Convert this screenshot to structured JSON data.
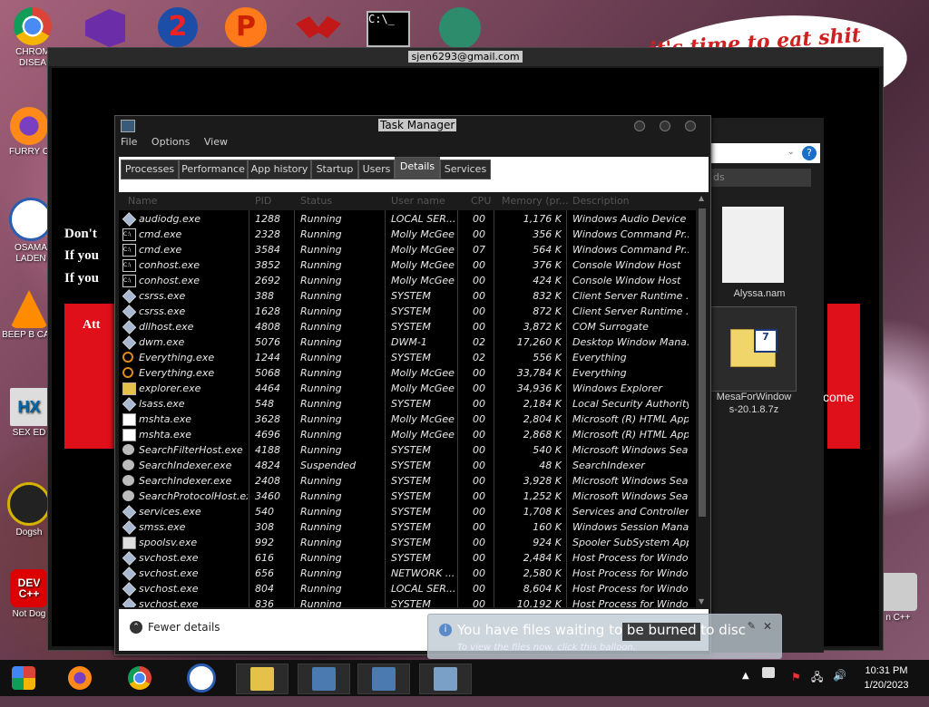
{
  "desktop": {
    "speech_text": "it's time to eat shit",
    "speech_text_fragment": "te",
    "icons": [
      {
        "label": "CHROM DISEA",
        "name": "chrome-desktop-icon"
      },
      {
        "label": "FURRY C",
        "name": "firefox-desktop-icon"
      },
      {
        "label": "OSAMA LADEN",
        "name": "obama-desktop-icon"
      },
      {
        "label": "BEEP B CAR",
        "name": "vlc-desktop-icon"
      },
      {
        "label": "SEX ED",
        "name": "hx-desktop-icon"
      },
      {
        "label": "Dogsh",
        "name": "dogsh-desktop-icon"
      },
      {
        "label": "Not Dog",
        "name": "devcpp-desktop-icon"
      }
    ],
    "right_icon_label": "n C++"
  },
  "bg_window": {
    "title": "sjen6293@gmail.com",
    "lines": [
      "Don't",
      "If you",
      "If you"
    ],
    "att": "Att",
    "come": "come"
  },
  "explorer": {
    "search_fragment": "ds",
    "file1": "Alyssa.nam",
    "file2_line1": "MesaForWindow",
    "file2_line2": "s-20.1.8.7z"
  },
  "task_manager": {
    "title": "Task Manager",
    "menu": [
      "File",
      "Options",
      "View"
    ],
    "tabs": [
      "Processes",
      "Performance",
      "App history",
      "Startup",
      "Users",
      "Details",
      "Services"
    ],
    "active_tab": "Details",
    "columns": [
      "Name",
      "PID",
      "Status",
      "User name",
      "CPU",
      "Memory (pr...",
      "Description"
    ],
    "rows": [
      {
        "icon": "gen",
        "name": "audiodg.exe",
        "pid": "1288",
        "status": "Running",
        "user": "LOCAL SER...",
        "cpu": "00",
        "mem": "1,176 K",
        "desc": "Windows Audio Device ..."
      },
      {
        "icon": "cmd",
        "name": "cmd.exe",
        "pid": "2328",
        "status": "Running",
        "user": "Molly McGee",
        "cpu": "00",
        "mem": "356 K",
        "desc": "Windows Command Pr..."
      },
      {
        "icon": "cmd",
        "name": "cmd.exe",
        "pid": "3584",
        "status": "Running",
        "user": "Molly McGee",
        "cpu": "07",
        "mem": "564 K",
        "desc": "Windows Command Pr..."
      },
      {
        "icon": "cmd",
        "name": "conhost.exe",
        "pid": "3852",
        "status": "Running",
        "user": "Molly McGee",
        "cpu": "00",
        "mem": "376 K",
        "desc": "Console Window Host"
      },
      {
        "icon": "cmd",
        "name": "conhost.exe",
        "pid": "2692",
        "status": "Running",
        "user": "Molly McGee",
        "cpu": "00",
        "mem": "424 K",
        "desc": "Console Window Host"
      },
      {
        "icon": "gen",
        "name": "csrss.exe",
        "pid": "388",
        "status": "Running",
        "user": "SYSTEM",
        "cpu": "00",
        "mem": "832 K",
        "desc": "Client Server Runtime ..."
      },
      {
        "icon": "gen",
        "name": "csrss.exe",
        "pid": "1628",
        "status": "Running",
        "user": "SYSTEM",
        "cpu": "00",
        "mem": "872 K",
        "desc": "Client Server Runtime ..."
      },
      {
        "icon": "gen",
        "name": "dllhost.exe",
        "pid": "4808",
        "status": "Running",
        "user": "SYSTEM",
        "cpu": "00",
        "mem": "3,872 K",
        "desc": "COM Surrogate"
      },
      {
        "icon": "gen",
        "name": "dwm.exe",
        "pid": "5076",
        "status": "Running",
        "user": "DWM-1",
        "cpu": "02",
        "mem": "17,260 K",
        "desc": "Desktop Window Mana..."
      },
      {
        "icon": "search",
        "name": "Everything.exe",
        "pid": "1244",
        "status": "Running",
        "user": "SYSTEM",
        "cpu": "02",
        "mem": "556 K",
        "desc": "Everything"
      },
      {
        "icon": "search",
        "name": "Everything.exe",
        "pid": "5068",
        "status": "Running",
        "user": "Molly McGee",
        "cpu": "00",
        "mem": "33,784 K",
        "desc": "Everything"
      },
      {
        "icon": "explorer",
        "name": "explorer.exe",
        "pid": "4464",
        "status": "Running",
        "user": "Molly McGee",
        "cpu": "00",
        "mem": "34,936 K",
        "desc": "Windows Explorer"
      },
      {
        "icon": "gen",
        "name": "lsass.exe",
        "pid": "548",
        "status": "Running",
        "user": "SYSTEM",
        "cpu": "00",
        "mem": "2,184 K",
        "desc": "Local Security Authority..."
      },
      {
        "icon": "mshta",
        "name": "mshta.exe",
        "pid": "3628",
        "status": "Running",
        "user": "Molly McGee",
        "cpu": "00",
        "mem": "2,804 K",
        "desc": "Microsoft (R) HTML App..."
      },
      {
        "icon": "mshta",
        "name": "mshta.exe",
        "pid": "4696",
        "status": "Running",
        "user": "Molly McGee",
        "cpu": "00",
        "mem": "2,868 K",
        "desc": "Microsoft (R) HTML App..."
      },
      {
        "icon": "gear",
        "name": "SearchFilterHost.exe",
        "pid": "4188",
        "status": "Running",
        "user": "SYSTEM",
        "cpu": "00",
        "mem": "540 K",
        "desc": "Microsoft Windows Sea..."
      },
      {
        "icon": "gear",
        "name": "SearchIndexer.exe",
        "pid": "4824",
        "status": "Suspended",
        "user": "SYSTEM",
        "cpu": "00",
        "mem": "48 K",
        "desc": "SearchIndexer"
      },
      {
        "icon": "gear",
        "name": "SearchIndexer.exe",
        "pid": "2408",
        "status": "Running",
        "user": "SYSTEM",
        "cpu": "00",
        "mem": "3,928 K",
        "desc": "Microsoft Windows Sea..."
      },
      {
        "icon": "gear",
        "name": "SearchProtocolHost.exe",
        "pid": "3460",
        "status": "Running",
        "user": "SYSTEM",
        "cpu": "00",
        "mem": "1,252 K",
        "desc": "Microsoft Windows Sea..."
      },
      {
        "icon": "gen",
        "name": "services.exe",
        "pid": "540",
        "status": "Running",
        "user": "SYSTEM",
        "cpu": "00",
        "mem": "1,708 K",
        "desc": "Services and Controller ..."
      },
      {
        "icon": "gen",
        "name": "smss.exe",
        "pid": "308",
        "status": "Running",
        "user": "SYSTEM",
        "cpu": "00",
        "mem": "160 K",
        "desc": "Windows Session Mana..."
      },
      {
        "icon": "print",
        "name": "spoolsv.exe",
        "pid": "992",
        "status": "Running",
        "user": "SYSTEM",
        "cpu": "00",
        "mem": "924 K",
        "desc": "Spooler SubSystem App"
      },
      {
        "icon": "gen",
        "name": "svchost.exe",
        "pid": "616",
        "status": "Running",
        "user": "SYSTEM",
        "cpu": "00",
        "mem": "2,484 K",
        "desc": "Host Process for Windo..."
      },
      {
        "icon": "gen",
        "name": "svchost.exe",
        "pid": "656",
        "status": "Running",
        "user": "NETWORK ...",
        "cpu": "00",
        "mem": "2,580 K",
        "desc": "Host Process for Windo..."
      },
      {
        "icon": "gen",
        "name": "svchost.exe",
        "pid": "804",
        "status": "Running",
        "user": "LOCAL SER...",
        "cpu": "00",
        "mem": "8,604 K",
        "desc": "Host Process for Windo..."
      },
      {
        "icon": "gen",
        "name": "svchost.exe",
        "pid": "836",
        "status": "Running",
        "user": "SYSTEM",
        "cpu": "00",
        "mem": "10,192 K",
        "desc": "Host Process for Windo..."
      }
    ],
    "fewer_details": "Fewer details"
  },
  "balloon": {
    "title": "You have files waiting to be burned to disc",
    "subtitle": "To view the files now, click this balloon."
  },
  "taskbar": {
    "time": "10:31 PM",
    "date": "1/20/2023"
  }
}
